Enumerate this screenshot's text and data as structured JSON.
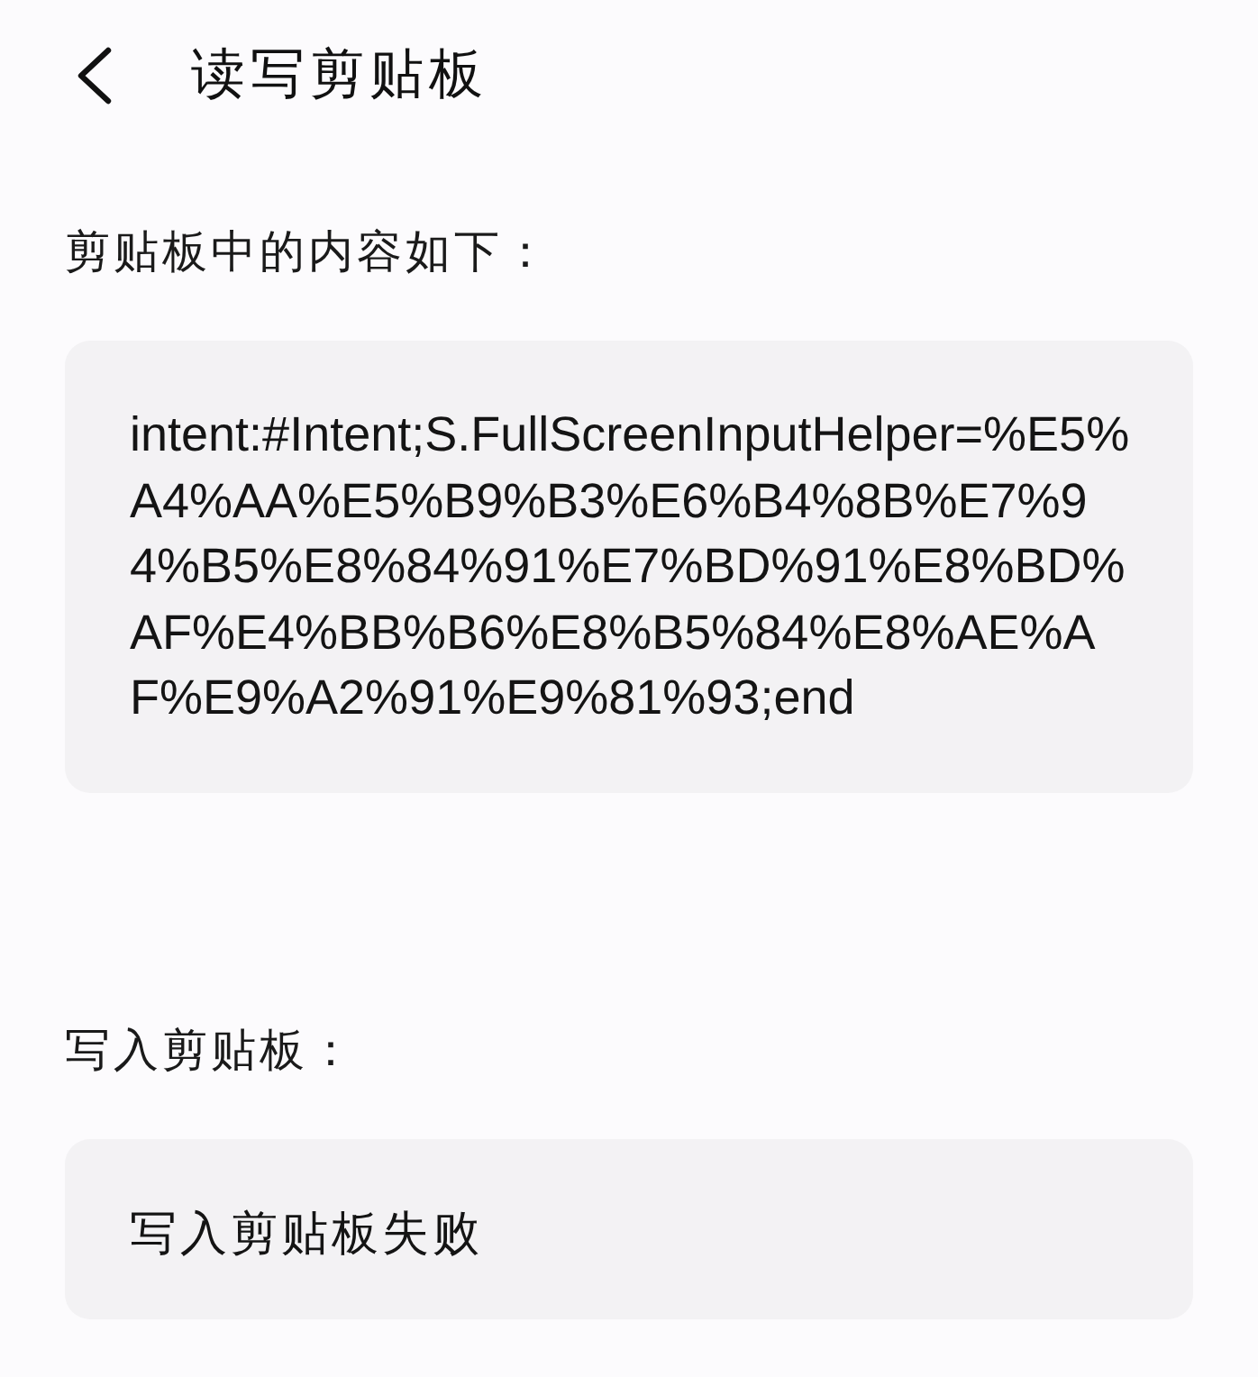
{
  "header": {
    "title": "读写剪贴板"
  },
  "sections": [
    {
      "label": "剪贴板中的内容如下：",
      "content": "intent:#Intent;S.FullScreenInputHelper=%E5%A4%AA%E5%B9%B3%E6%B4%8B%E7%94%B5%E8%84%91%E7%BD%91%E8%BD%AF%E4%BB%B6%E8%B5%84%E8%AE%AF%E9%A2%91%E9%81%93;end"
    },
    {
      "label": "写入剪贴板：",
      "content": "写入剪贴板失败"
    }
  ]
}
